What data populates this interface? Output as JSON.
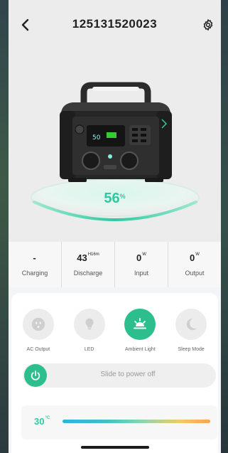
{
  "header": {
    "title": "125131520023"
  },
  "battery": {
    "percent": "56",
    "unit": "%"
  },
  "stats": [
    {
      "value": "-",
      "unit": "",
      "label": "Charging"
    },
    {
      "value": "43",
      "unit": "H16m",
      "label": "Discharge"
    },
    {
      "value": "0",
      "unit": "W",
      "label": "Input"
    },
    {
      "value": "0",
      "unit": "W",
      "label": "Output"
    }
  ],
  "modes": [
    {
      "label": "AC Output",
      "icon": "outlet-icon",
      "active": false
    },
    {
      "label": "LED",
      "icon": "bulb-icon",
      "active": false
    },
    {
      "label": "Ambient Light",
      "icon": "sunrise-icon",
      "active": true
    },
    {
      "label": "Sleep Mode",
      "icon": "moon-icon",
      "active": false
    }
  ],
  "power": {
    "label": "Slide to power off"
  },
  "light": {
    "temperature": "30",
    "unit": "°C"
  },
  "colors": {
    "accent": "#2dbe8d",
    "percent_text": "#2ec9a0"
  }
}
